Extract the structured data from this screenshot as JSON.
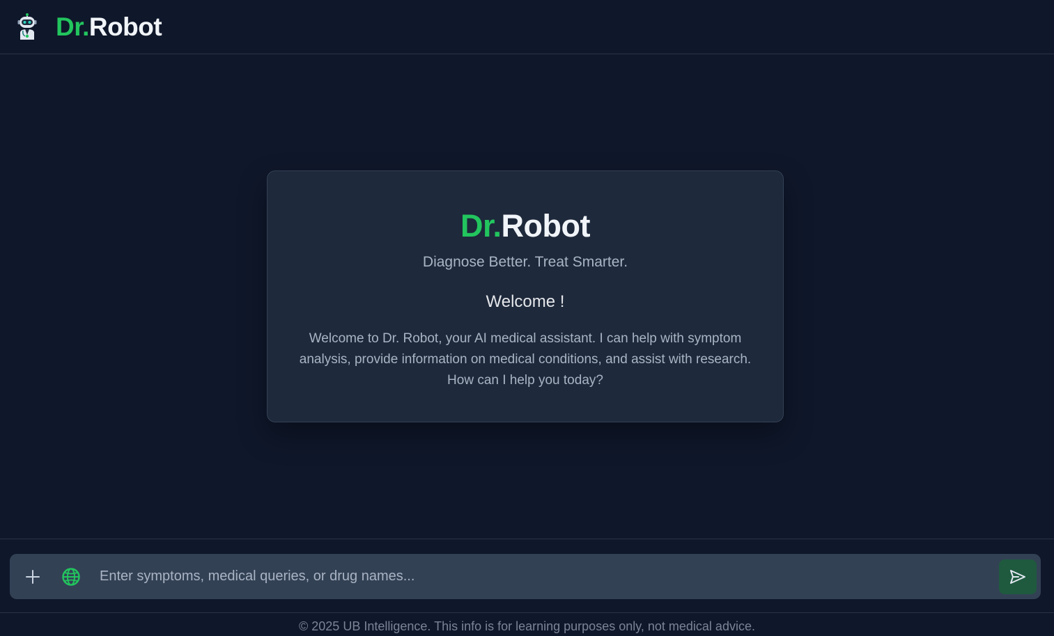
{
  "header": {
    "logo_icon": "robot-doctor-icon",
    "brand_accent": "Dr.",
    "brand_rest": "Robot"
  },
  "welcome_card": {
    "brand_accent": "Dr.",
    "brand_rest": "Robot",
    "tagline": "Diagnose Better. Treat Smarter.",
    "title": "Welcome !",
    "body": "Welcome to Dr. Robot, your AI medical assistant. I can help with symptom analysis, provide information on medical conditions, and assist with research. How can I help you today?"
  },
  "composer": {
    "attach_icon": "plus-icon",
    "web_icon": "globe-icon",
    "placeholder": "Enter symptoms, medical queries, or drug names...",
    "value": "",
    "send_icon": "send-icon"
  },
  "footer": {
    "text": "© 2025 UB Intelligence. This info is for learning purposes only, not medical advice."
  },
  "colors": {
    "background": "#0f172a",
    "card": "#1e293b",
    "input": "#334155",
    "accent": "#22c55e",
    "send_button": "#1f5a3f"
  }
}
